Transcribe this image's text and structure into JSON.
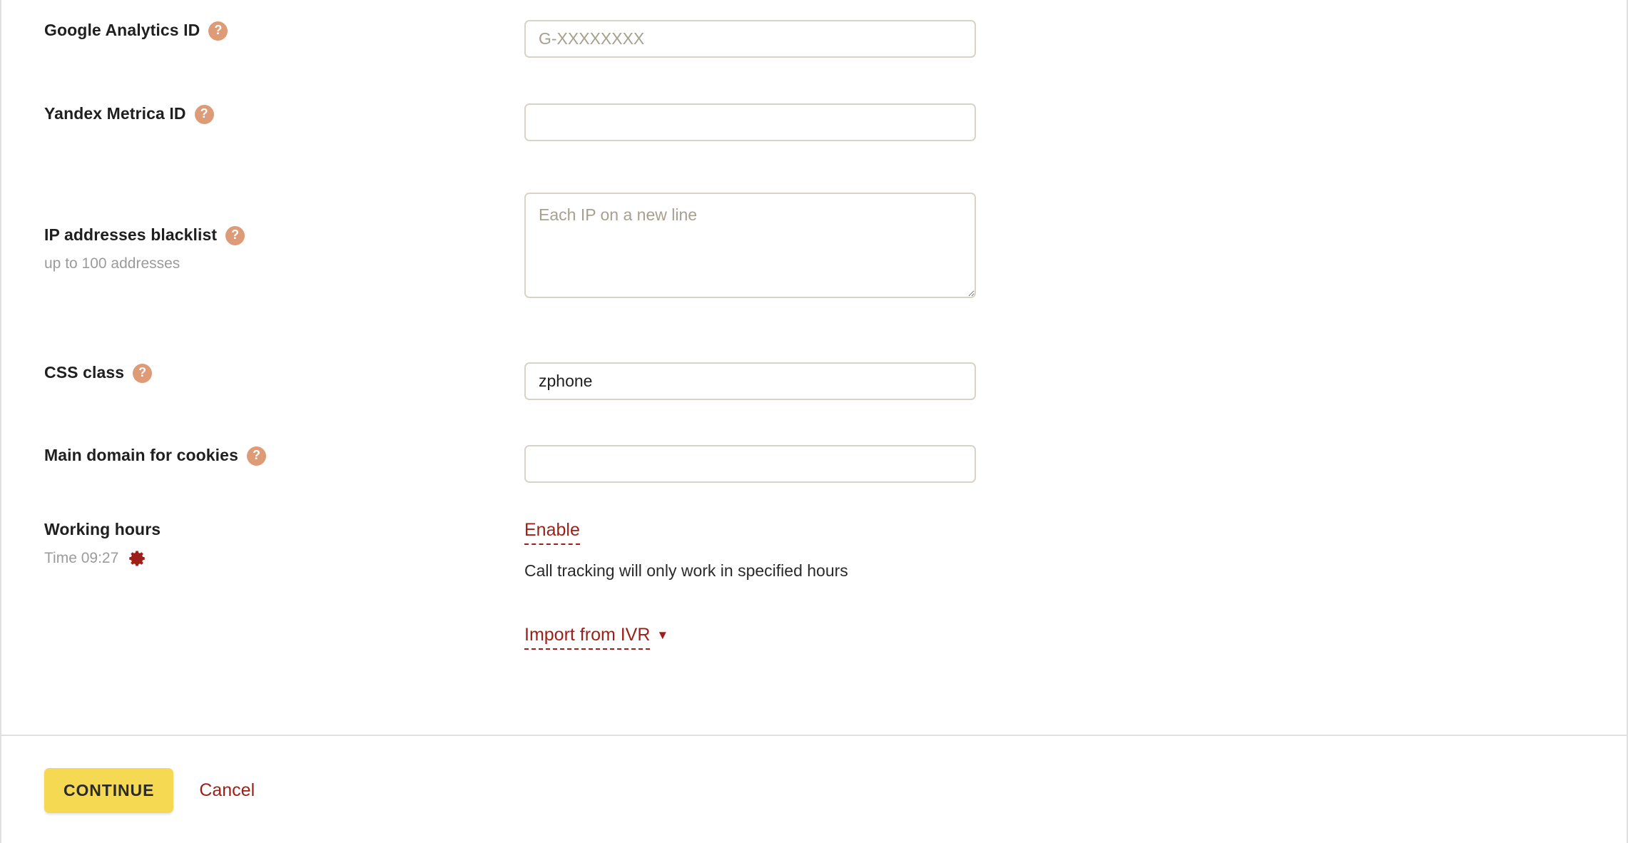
{
  "colors": {
    "help_icon": "#dd9b77",
    "accent_link": "#9e1f18",
    "button_primary": "#f6d952",
    "input_border": "#d9d3c7",
    "muted_text": "#9b9b9b"
  },
  "form": {
    "fields": [
      {
        "label": "Google Analytics ID",
        "help_icon": "question-mark-icon",
        "sub": "",
        "control": "input",
        "value": "",
        "placeholder": "G-XXXXXXXX"
      },
      {
        "label": "Yandex Metrica ID",
        "help_icon": "question-mark-icon",
        "sub": "",
        "control": "input",
        "value": "",
        "placeholder": ""
      },
      {
        "label": "IP addresses blacklist",
        "help_icon": "question-mark-icon",
        "sub": "up to 100 addresses",
        "control": "textarea",
        "value": "",
        "placeholder": "Each IP on a new line"
      },
      {
        "label": "CSS class",
        "help_icon": "question-mark-icon",
        "sub": "",
        "control": "input",
        "value": "zphone",
        "placeholder": ""
      },
      {
        "label": "Main domain for cookies",
        "help_icon": "question-mark-icon",
        "sub": "",
        "control": "input",
        "value": "",
        "placeholder": ""
      }
    ],
    "working_hours": {
      "label": "Working hours",
      "time_text": "Time 09:27",
      "gear_icon": "gear-icon",
      "enable_link": "Enable",
      "note": "Call tracking will only work in specified hours",
      "import_link": "Import from IVR",
      "import_caret": "chevron-down-icon"
    }
  },
  "footer": {
    "continue_label": "CONTINUE",
    "cancel_label": "Cancel"
  }
}
